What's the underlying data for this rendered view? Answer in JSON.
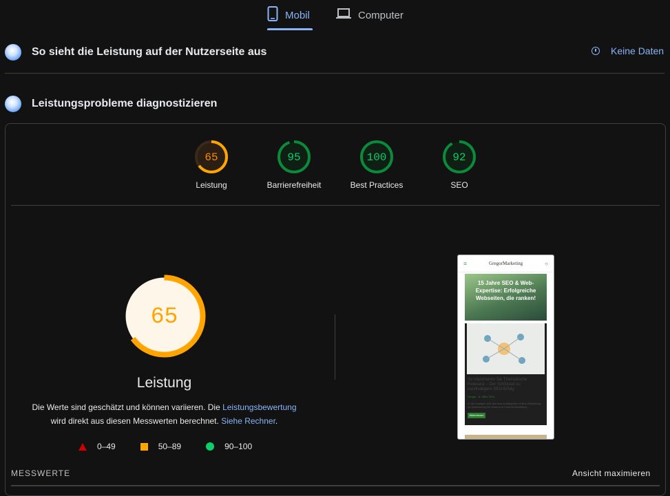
{
  "tabs": [
    {
      "label": "Mobil",
      "icon": "phone-icon",
      "active": true
    },
    {
      "label": "Computer",
      "icon": "laptop-icon",
      "active": false
    }
  ],
  "field_section": {
    "title": "So sieht die Leistung auf der Nutzerseite aus",
    "status": "Keine Daten",
    "status_icon": "info-icon"
  },
  "diagnose_section": {
    "title": "Leistungsprobleme diagnostizieren"
  },
  "scores": [
    {
      "value": "65",
      "label": "Leistung",
      "score": 65,
      "color": "#ff8a00"
    },
    {
      "value": "95",
      "label": "Barrierefreiheit",
      "score": 95,
      "color": "#0cce6b"
    },
    {
      "value": "100",
      "label": "Best Practices",
      "score": 100,
      "color": "#0cce6b"
    },
    {
      "value": "92",
      "label": "SEO",
      "score": 92,
      "color": "#0cce6b"
    }
  ],
  "main_score": {
    "value": "65",
    "score": 65,
    "title": "Leistung",
    "desc_part1": "Die Werte sind geschätzt und können variieren. Die ",
    "desc_link1": "Leistungsbewertung",
    "desc_part2": "wird direkt aus diesen Messwerten berechnet. ",
    "desc_link2": "Siehe Rechner",
    "desc_part3": "."
  },
  "legend": [
    {
      "label": "0–49",
      "shape": "triangle",
      "color": "#cc0000"
    },
    {
      "label": "50–89",
      "shape": "square",
      "color": "#ffa400"
    },
    {
      "label": "90–100",
      "shape": "circle",
      "color": "#0cce6b"
    }
  ],
  "screenshot": {
    "site_name": "GregorMarketing",
    "hero_text": "15 Jahre SEO & Web-Expertise: Erfolgreiche Webseiten, die ranken!",
    "post_title": "So maximieren Sie Thematische Relevanz – Der Schlüssel zu nachhaltigem SEO-Erfolg",
    "post_meta": "Gregor · 6. März 2024",
    "post_excerpt": "In der heutigen Zeit des hart umkämpften Online-Marketings ist Optimierung ein Muss und Content Marketing...",
    "button": "Weiterlesen"
  },
  "footer": {
    "metrics_label": "MESSWERTE",
    "expand_label": "Ansicht maximieren"
  }
}
